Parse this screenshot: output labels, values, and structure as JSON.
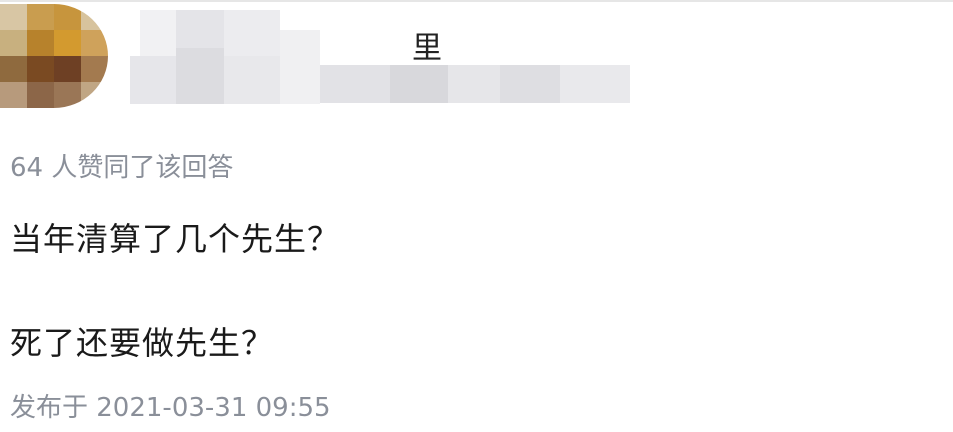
{
  "answer": {
    "author": {
      "name_visible_fragment": "里"
    },
    "likes_text": "64 人赞同了该回答",
    "content_lines": [
      "当年清算了几个先生？",
      "死了还要做先生？"
    ],
    "published_text": "发布于 2021-03-31 09:55"
  },
  "colors": {
    "meta_text": "#8a8f99",
    "body_text": "#1a1a1a",
    "mosaic_light": "#e9e9ec",
    "mosaic_mid": "#d8d8dc"
  }
}
